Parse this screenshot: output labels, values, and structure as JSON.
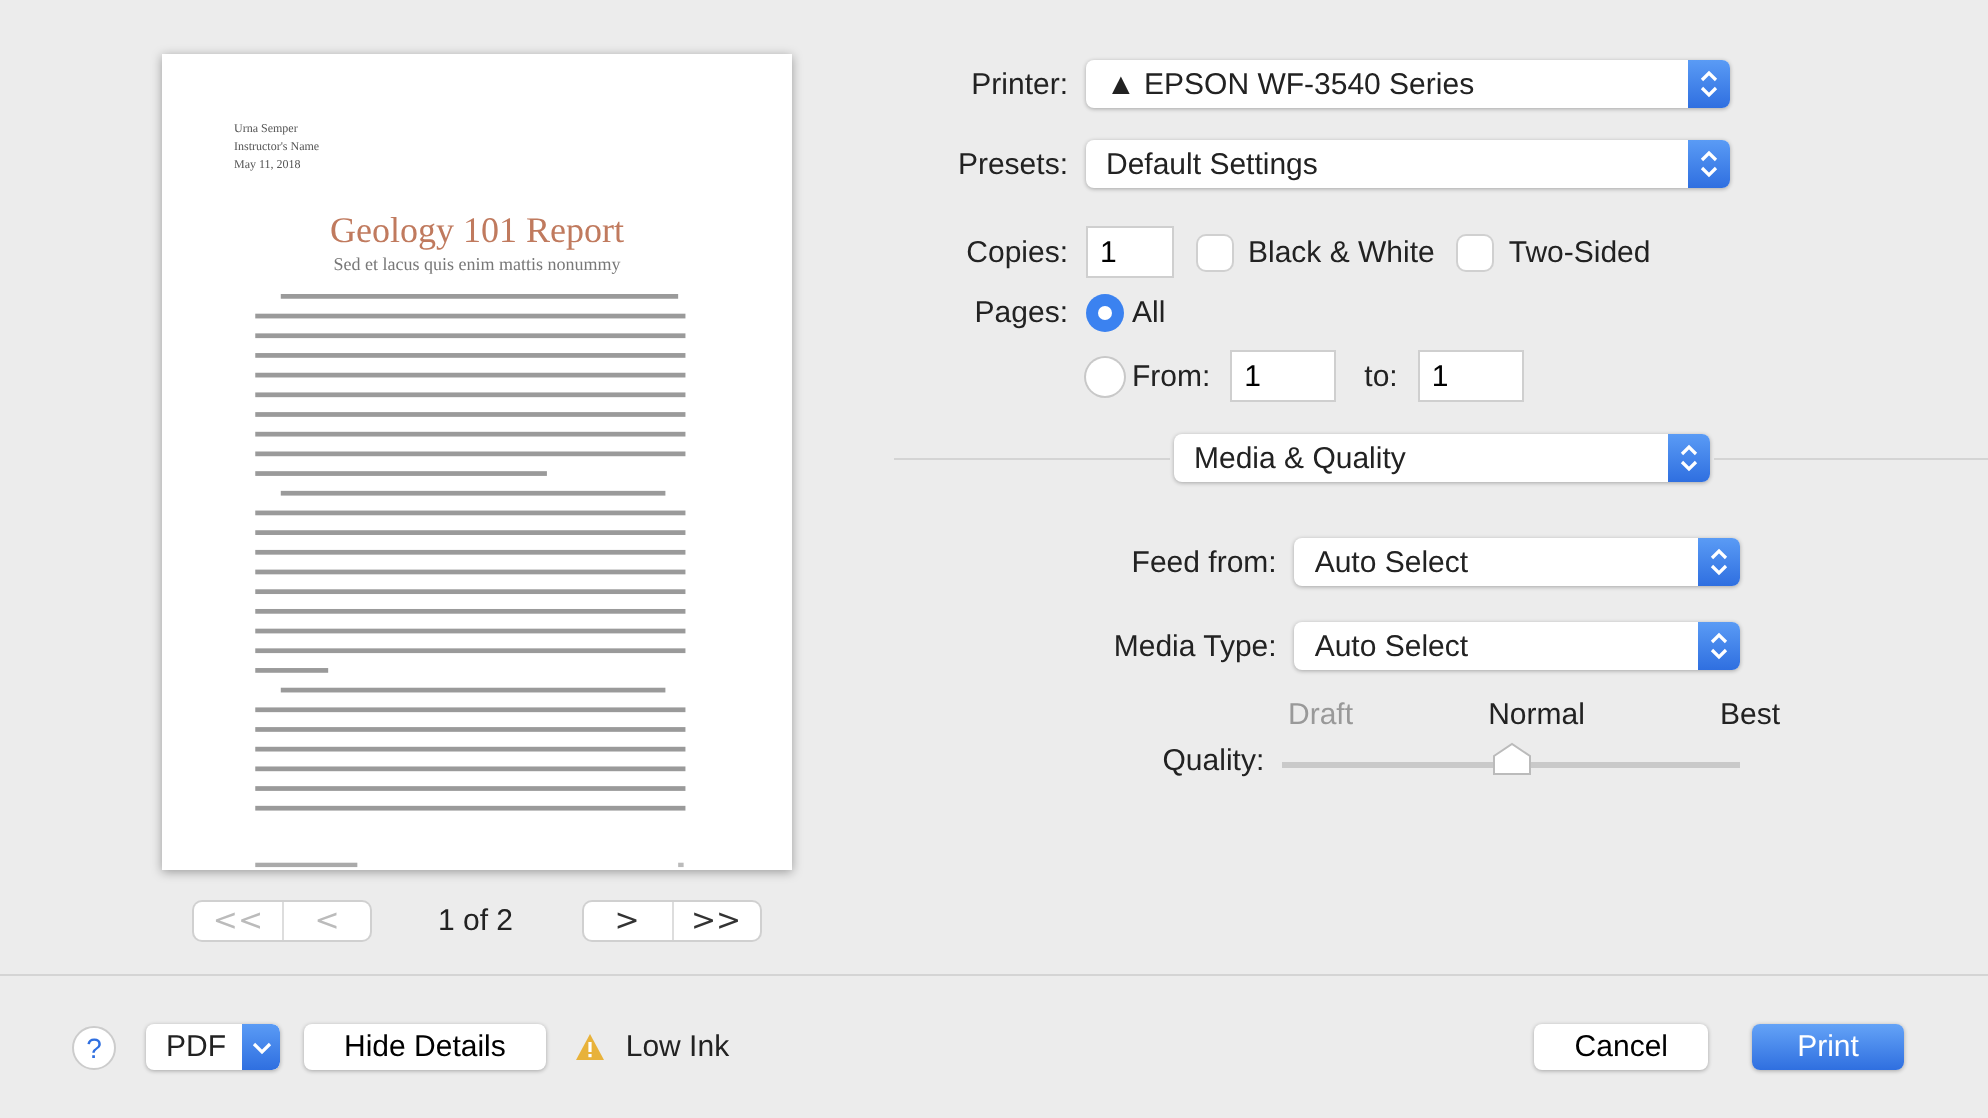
{
  "preview": {
    "header_lines": [
      "Urna Semper",
      "Instructor's Name",
      "May 11, 2018"
    ],
    "title": "Geology 101 Report",
    "subtitle": "Sed et lacus quis enim mattis nonummy",
    "nav": {
      "first": "<<",
      "prev": "<",
      "page": "1 of 2",
      "next": ">",
      "last": ">>"
    }
  },
  "printer": {
    "label": "Printer:",
    "value": "▲ EPSON WF-3540 Series"
  },
  "presets": {
    "label": "Presets:",
    "value": "Default Settings"
  },
  "copies": {
    "label": "Copies:",
    "value": "1",
    "options": [
      {
        "label": "Black & White",
        "checked": false
      },
      {
        "label": "Two-Sided",
        "checked": false
      }
    ]
  },
  "pages": {
    "label": "Pages:",
    "options": [
      {
        "kind": "all",
        "label": "All",
        "selected": true
      },
      {
        "kind": "range",
        "label": "From:",
        "selected": false,
        "from": "1",
        "to_label": "to:",
        "to": "1"
      }
    ]
  },
  "panel": {
    "value": "Media & Quality"
  },
  "fields": [
    {
      "label": "Feed from:",
      "value": "Auto Select"
    },
    {
      "label": "Media Type:",
      "value": "Auto Select"
    }
  ],
  "quality": {
    "label": "Quality:",
    "ticks": [
      "Draft",
      "Normal",
      "Best"
    ],
    "level": 0.5
  },
  "footer": {
    "help": "?",
    "pdf": "PDF",
    "details": "Hide Details",
    "status": "Low Ink",
    "cancel": "Cancel",
    "print": "Print"
  }
}
